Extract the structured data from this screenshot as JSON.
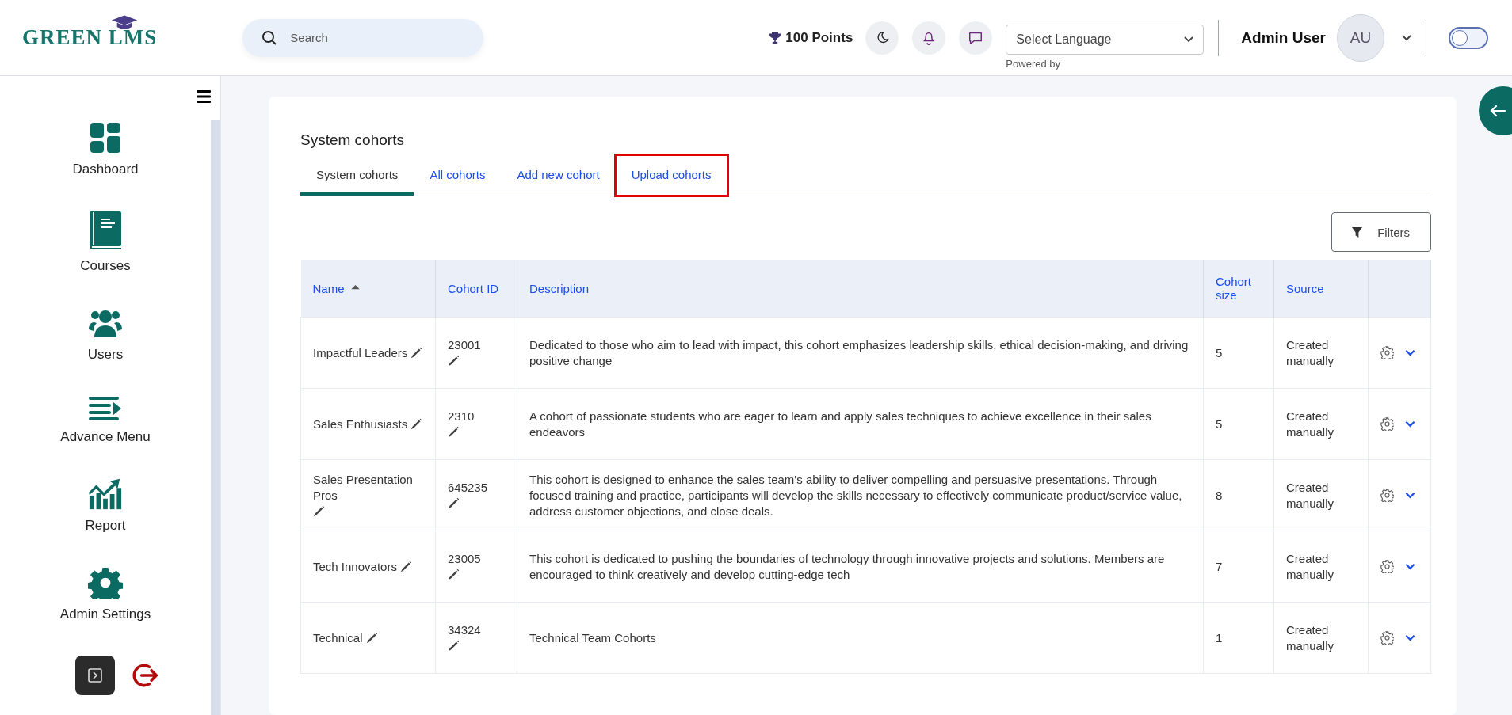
{
  "header": {
    "logo": "GREEN LMS",
    "search": {
      "placeholder": "Search"
    },
    "points": "100 Points",
    "language": {
      "value": "Select Language",
      "note": "Powered by"
    },
    "user": {
      "name": "Admin User",
      "initials": "AU"
    },
    "toggle": {
      "on": false
    }
  },
  "sidebar": {
    "items": [
      {
        "label": "Dashboard",
        "kind": "grid"
      },
      {
        "label": "Courses",
        "kind": "book"
      },
      {
        "label": "Users",
        "kind": "users"
      },
      {
        "label": "Advance Menu",
        "kind": "menu"
      },
      {
        "label": "Report",
        "kind": "chart"
      },
      {
        "label": "Admin Settings",
        "kind": "gear"
      },
      {
        "kind": "logout"
      }
    ]
  },
  "page": {
    "title": "System cohorts",
    "tabs": [
      {
        "label": "System cohorts",
        "selected": true,
        "highlighted": false
      },
      {
        "label": "All cohorts",
        "selected": false,
        "highlighted": false
      },
      {
        "label": "Add new cohort",
        "selected": false,
        "highlighted": false
      },
      {
        "label": "Upload cohorts",
        "selected": false,
        "highlighted": true
      }
    ],
    "filters": "Filters",
    "table": {
      "columns": [
        {
          "label": "Name",
          "sorted": true
        },
        {
          "label": "Cohort ID",
          "sorted": false
        },
        {
          "label": "Description",
          "sorted": false
        },
        {
          "label": "Cohort size",
          "sorted": false
        },
        {
          "label": "Source",
          "sorted": false
        }
      ],
      "rows": [
        {
          "name": "Impactful Leaders",
          "id": "23001",
          "description": "Dedicated to those who aim to lead with impact, this cohort emphasizes leadership skills, ethical decision-making, and driving positive change",
          "size": "5",
          "source": "Created manually"
        },
        {
          "name": "Sales Enthusiasts",
          "id": "2310",
          "description": "A cohort of passionate students who are eager to learn and apply sales techniques to achieve excellence in their sales endeavors",
          "size": "5",
          "source": "Created manually"
        },
        {
          "name": "Sales Presentation Pros",
          "id": "645235",
          "description": "This cohort is designed to enhance the sales team's ability to deliver compelling and persuasive presentations. Through focused training and practice, participants will develop the skills necessary to effectively communicate product/service value, address customer objections, and close deals.",
          "size": "8",
          "source": "Created manually"
        },
        {
          "name": "Tech Innovators",
          "id": "23005",
          "description": "This cohort is dedicated to pushing the boundaries of technology through innovative projects and solutions. Members are encouraged to think creatively and develop cutting-edge tech",
          "size": "7",
          "source": "Created manually"
        },
        {
          "name": "Technical",
          "id": "34324",
          "description": "Technical Team Cohorts",
          "size": "1",
          "source": "Created manually"
        }
      ]
    }
  }
}
